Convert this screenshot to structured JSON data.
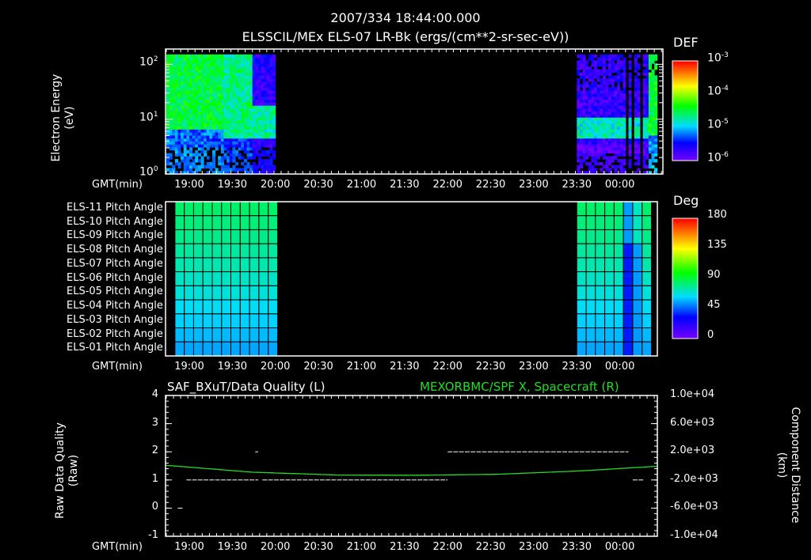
{
  "header": {
    "datetime": "2007/334 18:44:00.000",
    "title": "ELSSCIL/MEx ELS-07 LR-Bk  (ergs/(cm**2-sr-sec-eV))"
  },
  "chart_data": [
    {
      "type": "heatmap",
      "name": "energy-spectrogram",
      "ylabel_line1": "Electron Energy",
      "ylabel_line2": "(eV)",
      "xlabel": "GMT(min)",
      "x_ticks": [
        "19:00",
        "19:30",
        "20:00",
        "20:30",
        "21:00",
        "21:30",
        "22:00",
        "22:30",
        "23:00",
        "23:30",
        "00:00"
      ],
      "x_range_min": [
        0,
        346
      ],
      "x_start": "18:44",
      "y_scale": "log",
      "y_ticks": [
        {
          "base": "10",
          "exp": "0",
          "value": 1
        },
        {
          "base": "10",
          "exp": "1",
          "value": 10
        },
        {
          "base": "10",
          "exp": "2",
          "value": 100
        }
      ],
      "ylim": [
        1,
        190
      ],
      "colorbar": {
        "label": "DEF",
        "scale": "log",
        "range": [
          1e-06,
          0.001
        ],
        "ticks": [
          {
            "base": "10",
            "exp": "-3"
          },
          {
            "base": "10",
            "exp": "-4"
          },
          {
            "base": "10",
            "exp": "-5"
          },
          {
            "base": "10",
            "exp": "-6"
          }
        ]
      },
      "data_intervals": [
        [
          "18:44",
          "20:00"
        ],
        [
          "23:30",
          "00:26"
        ]
      ],
      "peak_energy_band_eV": {
        "first_interval": [
          6,
          150
        ],
        "second_interval": [
          4,
          10
        ]
      }
    },
    {
      "type": "heatmap",
      "name": "pitch-angle",
      "xlabel": "GMT(min)",
      "rows": [
        "ELS-11 Pitch Angle",
        "ELS-10 Pitch Angle",
        "ELS-09 Pitch Angle",
        "ELS-08 Pitch Angle",
        "ELS-07 Pitch Angle",
        "ELS-06 Pitch Angle",
        "ELS-05 Pitch Angle",
        "ELS-04 Pitch Angle",
        "ELS-03 Pitch Angle",
        "ELS-02 Pitch Angle",
        "ELS-01 Pitch Angle"
      ],
      "row_values_deg": [
        100,
        97,
        94,
        90,
        87,
        83,
        79,
        74,
        70,
        66,
        62
      ],
      "colorbar": {
        "label": "Deg",
        "range": [
          0,
          180
        ],
        "ticks": [
          "180",
          "135",
          "90",
          "45",
          "0"
        ]
      },
      "data_intervals": [
        [
          "18:50",
          "20:00"
        ],
        [
          "23:30",
          "00:24"
        ]
      ]
    },
    {
      "type": "line",
      "name": "data-quality",
      "title_left": "SAF_BXuT/Data Quality (L)",
      "title_right": "MEXORBMC/SPF X, Spacecraft (R)",
      "ylabel_left_line1": "Raw Data Quality",
      "ylabel_left_line2": "(Raw)",
      "ylabel_right_line1": "Component Distance",
      "ylabel_right_line2": "(km)",
      "xlabel": "GMT(min)",
      "ylim_left": [
        -1,
        4
      ],
      "yticks_left": [
        "4",
        "3",
        "2",
        "1",
        "0",
        "-1"
      ],
      "ylim_right": [
        -10000,
        10000
      ],
      "yticks_right": [
        "1.0e+04",
        "6.0e+03",
        "2.0e+03",
        "-2.0e+03",
        "-6.0e+03",
        "-1.0e+04"
      ],
      "quality_segments": [
        {
          "from_min": 8,
          "to_min": 12,
          "value": 0
        },
        {
          "from_min": 14,
          "to_min": 64,
          "value": 1
        },
        {
          "from_min": 62,
          "to_min": 64,
          "value": 2
        },
        {
          "from_min": 67,
          "to_min": 196,
          "value": 1
        },
        {
          "from_min": 196,
          "to_min": 322,
          "value": 2
        },
        {
          "from_min": 325,
          "to_min": 333,
          "value": 1
        }
      ],
      "spacecraft_x_km": {
        "x_min": [
          0,
          60,
          120,
          173,
          230,
          290,
          346
        ],
        "values": [
          80,
          -900,
          -1300,
          -1330,
          -1200,
          -700,
          0
        ]
      },
      "series_color": "#22dd22"
    }
  ]
}
